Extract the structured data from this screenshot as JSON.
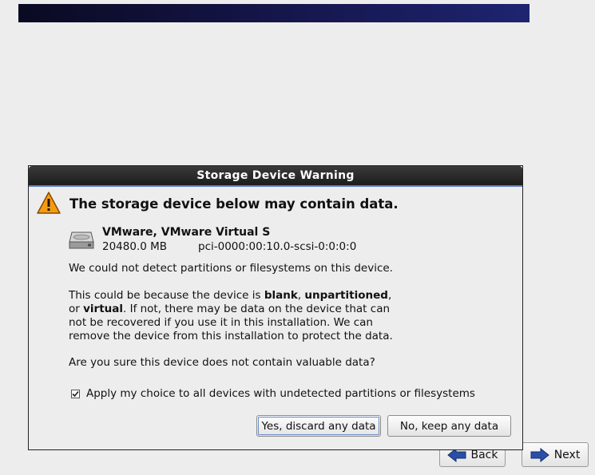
{
  "banner": {},
  "nav": {
    "back_label": "Back",
    "next_label": "Next"
  },
  "dialog": {
    "title": "Storage Device Warning",
    "heading": "The storage device below may contain data.",
    "device": {
      "name": "VMware, VMware Virtual S",
      "size": "20480.0 MB",
      "path": "pci-0000:00:10.0-scsi-0:0:0:0"
    },
    "message1": "We could not detect partitions or filesystems on this device.",
    "message2": {
      "part1": "This could be because the device is ",
      "bold1": "blank",
      "sep1": ", ",
      "bold2": "unpartitioned",
      "sep2": ",",
      "line2_prefix": "or ",
      "bold3": "virtual",
      "line2_rest": ". If not, there may be data on the device that can",
      "line3": "not be recovered if you use it in this installation. We can",
      "line4": "remove the device from this installation to protect the data."
    },
    "question": "Are you sure this device does not contain valuable data?",
    "apply_all": {
      "label": "Apply my choice to all devices with undetected partitions or filesystems",
      "checked": true
    },
    "yes_button": "Yes, discard any data",
    "no_button": "No, keep any data"
  },
  "icons": {
    "warning": "warning-icon",
    "disk": "hard-disk-icon",
    "back": "arrow-left-icon",
    "next": "arrow-right-icon"
  },
  "colors": {
    "banner": "#141446",
    "titlebar": "#1d1d1d",
    "arrow": "#2a4fa8",
    "warning": "#f39c12"
  }
}
